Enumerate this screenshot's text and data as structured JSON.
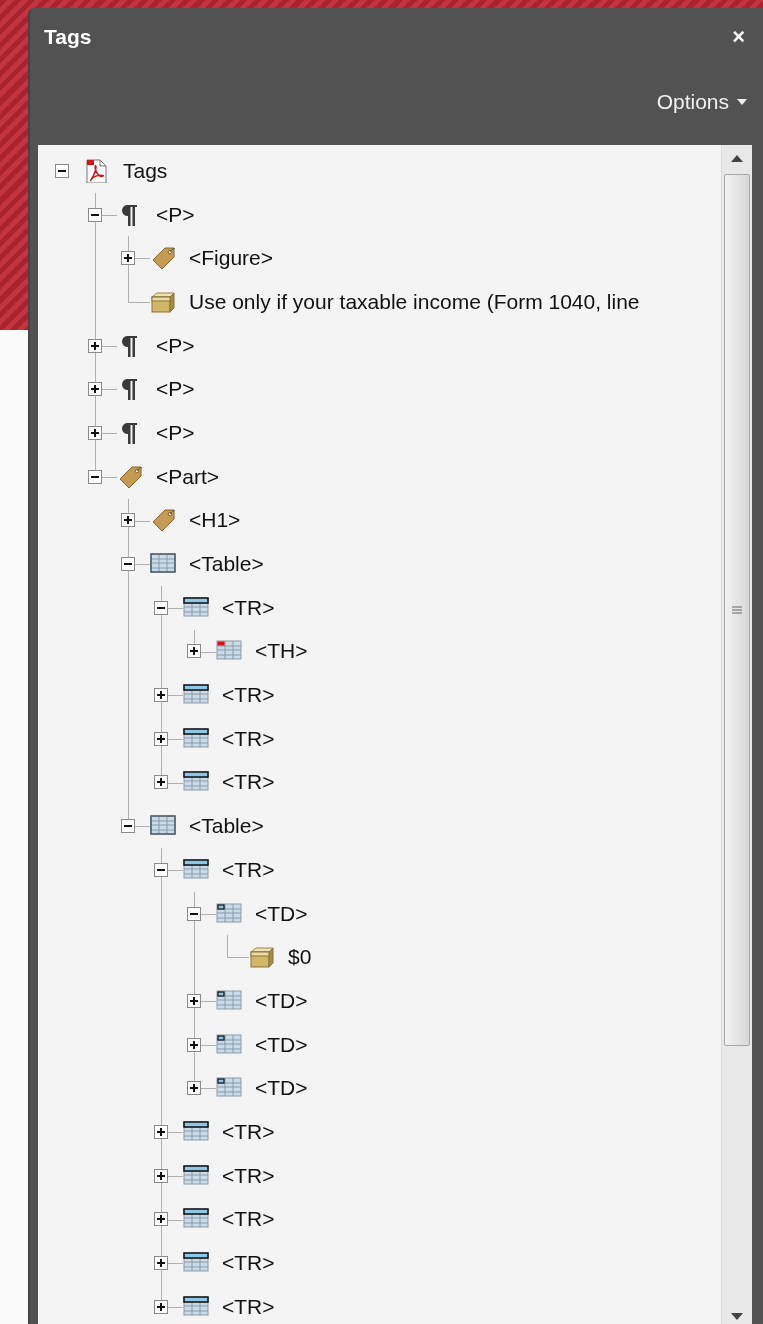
{
  "panel": {
    "title": "Tags",
    "close": "×",
    "options": "Options",
    "tree": [
      {
        "kind": "document",
        "label": "Tags",
        "expanded": true,
        "children": [
          {
            "kind": "paragraph",
            "label": "<P>",
            "expanded": true,
            "children": [
              {
                "kind": "tag",
                "label": "<Figure>",
                "expanded": false
              },
              {
                "kind": "content",
                "label": "Use only if your taxable income (Form 1040, line"
              }
            ]
          },
          {
            "kind": "paragraph",
            "label": "<P>",
            "expanded": false
          },
          {
            "kind": "paragraph",
            "label": "<P>",
            "expanded": false
          },
          {
            "kind": "paragraph",
            "label": "<P>",
            "expanded": false
          },
          {
            "kind": "tag",
            "label": "<Part>",
            "expanded": true,
            "children": [
              {
                "kind": "tag",
                "label": "<H1>",
                "expanded": false
              },
              {
                "kind": "table",
                "label": "<Table>",
                "expanded": true,
                "children": [
                  {
                    "kind": "row",
                    "label": "<TR>",
                    "expanded": true,
                    "children": [
                      {
                        "kind": "header-cell",
                        "label": "<TH>",
                        "expanded": false
                      }
                    ]
                  },
                  {
                    "kind": "row",
                    "label": "<TR>",
                    "expanded": false
                  },
                  {
                    "kind": "row",
                    "label": "<TR>",
                    "expanded": false
                  },
                  {
                    "kind": "row",
                    "label": "<TR>",
                    "expanded": false
                  }
                ]
              },
              {
                "kind": "table",
                "label": "<Table>",
                "expanded": true,
                "children": [
                  {
                    "kind": "row",
                    "label": "<TR>",
                    "expanded": true,
                    "children": [
                      {
                        "kind": "data-cell",
                        "label": "<TD>",
                        "expanded": true,
                        "children": [
                          {
                            "kind": "content",
                            "label": "$0"
                          }
                        ]
                      },
                      {
                        "kind": "data-cell",
                        "label": "<TD>",
                        "expanded": false
                      },
                      {
                        "kind": "data-cell",
                        "label": "<TD>",
                        "expanded": false
                      },
                      {
                        "kind": "data-cell",
                        "label": "<TD>",
                        "expanded": false
                      }
                    ]
                  },
                  {
                    "kind": "row",
                    "label": "<TR>",
                    "expanded": false
                  },
                  {
                    "kind": "row",
                    "label": "<TR>",
                    "expanded": false
                  },
                  {
                    "kind": "row",
                    "label": "<TR>",
                    "expanded": false
                  },
                  {
                    "kind": "row",
                    "label": "<TR>",
                    "expanded": false
                  },
                  {
                    "kind": "row",
                    "label": "<TR>",
                    "expanded": false
                  }
                ]
              }
            ]
          }
        ]
      }
    ]
  }
}
